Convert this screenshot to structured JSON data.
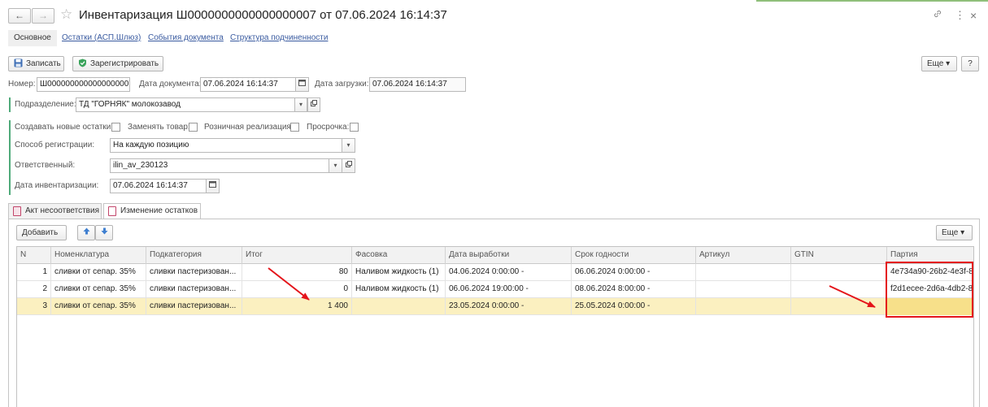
{
  "window": {
    "title": "Инвентаризация Ш0000000000000000007 от 07.06.2024 16:14:37",
    "back_glyph": "←",
    "forward_glyph": "→",
    "star_glyph": "☆",
    "link_glyph": "🔗",
    "more_glyph": "⋮",
    "close_glyph": "×"
  },
  "nav": {
    "tabs": [
      {
        "label": "Основное"
      },
      {
        "label": "Остатки (АСП.Шлюз)"
      },
      {
        "label": "События документа"
      },
      {
        "label": "Структура подчиненности"
      }
    ]
  },
  "toolbar": {
    "save_label": "Записать",
    "register_label": "Зарегистрировать",
    "more_label": "Еще ▾",
    "help_label": "?"
  },
  "header": {
    "number_label": "Номер:",
    "number_value": "Ш0000000000000000007",
    "doc_date_label": "Дата документа:",
    "doc_date_value": "07.06.2024 16:14:37",
    "load_date_label": "Дата загрузки:",
    "load_date_value": "07.06.2024 16:14:37",
    "division_label": "Подразделение:",
    "division_value": "ТД \"ГОРНЯК\" молокозавод"
  },
  "options": {
    "create_new_label": "Создавать новые остатки:",
    "replace_goods_label": "Заменять товар:",
    "retail_label": "Розничная реализация:",
    "overdue_label": "Просрочка:",
    "reg_method_label": "Способ регистрации:",
    "reg_method_value": "На каждую позицию",
    "responsible_label": "Ответственный:",
    "responsible_value": "ilin_av_230123",
    "inv_date_label": "Дата инвентаризации:",
    "inv_date_value": "07.06.2024 16:14:37"
  },
  "tabs": [
    {
      "label": "Акт несоответствия"
    },
    {
      "label": "Изменение остатков"
    }
  ],
  "table_toolbar": {
    "add_label": "Добавить",
    "up_glyph": "🡅",
    "down_glyph": "🡇",
    "more_label": "Еще ▾"
  },
  "table": {
    "columns": [
      "N",
      "Номенклатура",
      "Подкатегория",
      "Итог",
      "Фасовка",
      "Дата выработки",
      "Срок годности",
      "Артикул",
      "GTIN",
      "Партия"
    ],
    "rows": [
      {
        "n": "1",
        "nomen": "сливки от сепар. 35%",
        "subcat": "сливки пастеризован...",
        "total": "80",
        "pack": "Наливом жидкость (1)",
        "prod_date": "04.06.2024 0:00:00 -",
        "expiry": "06.06.2024 0:00:00 -",
        "article": "",
        "gtin": "",
        "batch": "4e734a90-26b2-4e3f-8..."
      },
      {
        "n": "2",
        "nomen": "сливки от сепар. 35%",
        "subcat": "сливки пастеризован...",
        "total": "0",
        "pack": "Наливом жидкость (1)",
        "prod_date": "06.06.2024 19:00:00 -",
        "expiry": "08.06.2024 8:00:00 -",
        "article": "",
        "gtin": "",
        "batch": "f2d1ecee-2d6a-4db2-8..."
      },
      {
        "n": "3",
        "nomen": "сливки от сепар. 35%",
        "subcat": "сливки пастеризован...",
        "total": "1 400",
        "pack": "",
        "prod_date": "23.05.2024 0:00:00 -",
        "expiry": "25.05.2024 0:00:00 -",
        "article": "",
        "gtin": "",
        "batch": ""
      }
    ]
  },
  "colors": {
    "accent_green": "#4faa7a",
    "selected_row": "#fbf0c0",
    "annotation_red": "#e4141a",
    "link_blue": "#3a5ba0"
  }
}
